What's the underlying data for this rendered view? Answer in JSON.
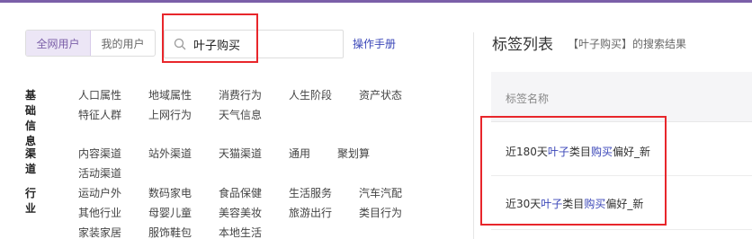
{
  "scope": {
    "all_users": "全网用户",
    "my_users": "我的用户"
  },
  "search": {
    "value": "叶子购买",
    "placeholder": ""
  },
  "manual_link": "操作手册",
  "categories": [
    {
      "label": "基础信息",
      "items": [
        "人口属性",
        "地域属性",
        "消费行为",
        "人生阶段",
        "资产状态",
        "特征人群",
        "上网行为",
        "天气信息"
      ]
    },
    {
      "label": "渠道",
      "items": [
        "内容渠道",
        "站外渠道",
        "天猫渠道",
        "通用",
        "聚划算",
        "活动渠道"
      ]
    },
    {
      "label": "行业",
      "items": [
        "运动户外",
        "数码家电",
        "食品保健",
        "生活服务",
        "汽车汽配",
        "其他行业",
        "母婴儿童",
        "美容美妆",
        "旅游出行",
        "类目行为",
        "家装家居",
        "服饰鞋包",
        "本地生活"
      ]
    }
  ],
  "panel": {
    "title": "标签列表",
    "subtitle": "【叶子购买】的搜索结果",
    "column_header": "标签名称",
    "rows": [
      {
        "prefix": "近180天",
        "kw1": "叶子",
        "mid": "类目",
        "kw2": "购买",
        "suffix": "偏好_新"
      },
      {
        "prefix": "近30天",
        "kw1": "叶子",
        "mid": "类目",
        "kw2": "购买",
        "suffix": "偏好_新"
      }
    ]
  },
  "colors": {
    "accent": "#7b5fa8",
    "link": "#3a46b8",
    "highlight_box": "#e8262b"
  }
}
